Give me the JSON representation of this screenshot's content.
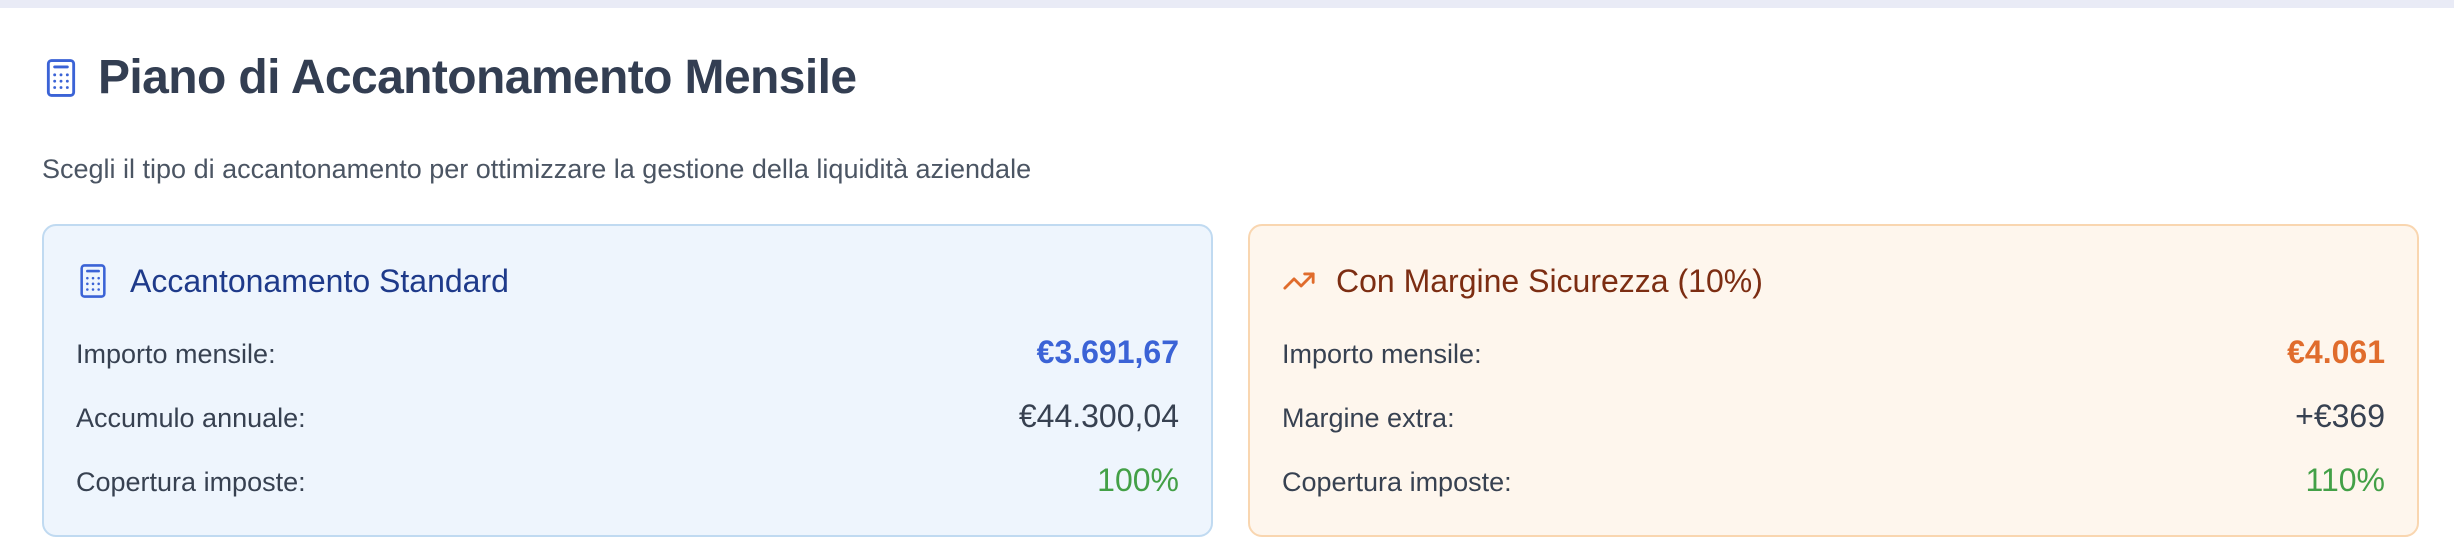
{
  "header": {
    "icon": "calculator-icon",
    "title": "Piano di Accantonamento Mensile",
    "subtitle": "Scegli il tipo di accantonamento per ottimizzare la gestione della liquidità aziendale"
  },
  "cards": [
    {
      "icon": "calculator-icon",
      "title": "Accantonamento Standard",
      "rows": [
        {
          "label": "Importo mensile:",
          "value": "€3.691,67"
        },
        {
          "label": "Accumulo annuale:",
          "value": "€44.300,04"
        },
        {
          "label": "Copertura imposte:",
          "value": "100%"
        }
      ]
    },
    {
      "icon": "trending-up-icon",
      "title": "Con Margine Sicurezza (10%)",
      "rows": [
        {
          "label": "Importo mensile:",
          "value": "€4.061"
        },
        {
          "label": "Margine extra:",
          "value": "+€369"
        },
        {
          "label": "Copertura imposte:",
          "value": "110%"
        }
      ]
    }
  ],
  "colors": {
    "accent_blue": "#3b63d6",
    "accent_orange": "#e06c2c",
    "positive_green": "#43a047"
  }
}
